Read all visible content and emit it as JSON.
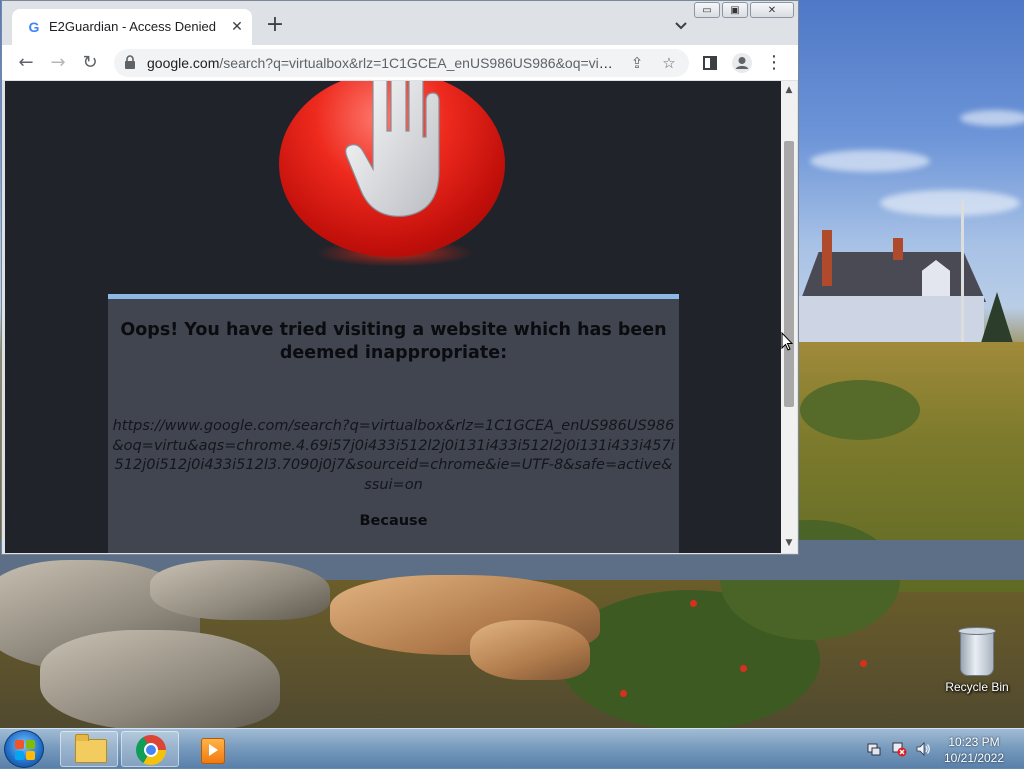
{
  "browser": {
    "tab_title": "E2Guardian - Access Denied",
    "tab_favicon": "G",
    "url_host": "google.com",
    "url_rest": "/search?q=virtualbox&rlz=1C1GCEA_enUS986US986&oq=virt...",
    "window_controls": {
      "minimize": "▭",
      "maximize": "▣",
      "close": "✕"
    }
  },
  "page": {
    "title": "Oops! You have tried visiting a website which has been deemed inappropriate:",
    "blocked_url": "https://www.google.com/search?q=virtualbox&rlz=1C1GCEA_enUS986US986&oq=virtu&aqs=chrome.4.69i57j0i433i512l2j0i131i433i512l2j0i131i433i457i512j0i512j0i433i512l3.7090j0j7&sourceid=chrome&ie=UTF-8&safe=active&ssui=on",
    "because_label": "Because"
  },
  "desktop": {
    "recycle_bin_label": "Recycle Bin"
  },
  "taskbar": {
    "time": "10:23 PM",
    "date": "10/21/2022"
  },
  "colors": {
    "page_bg": "#20232a",
    "box_bg": "#40454f",
    "box_top_border": "#8db9e8",
    "stop_red": "#ee2a1e"
  }
}
